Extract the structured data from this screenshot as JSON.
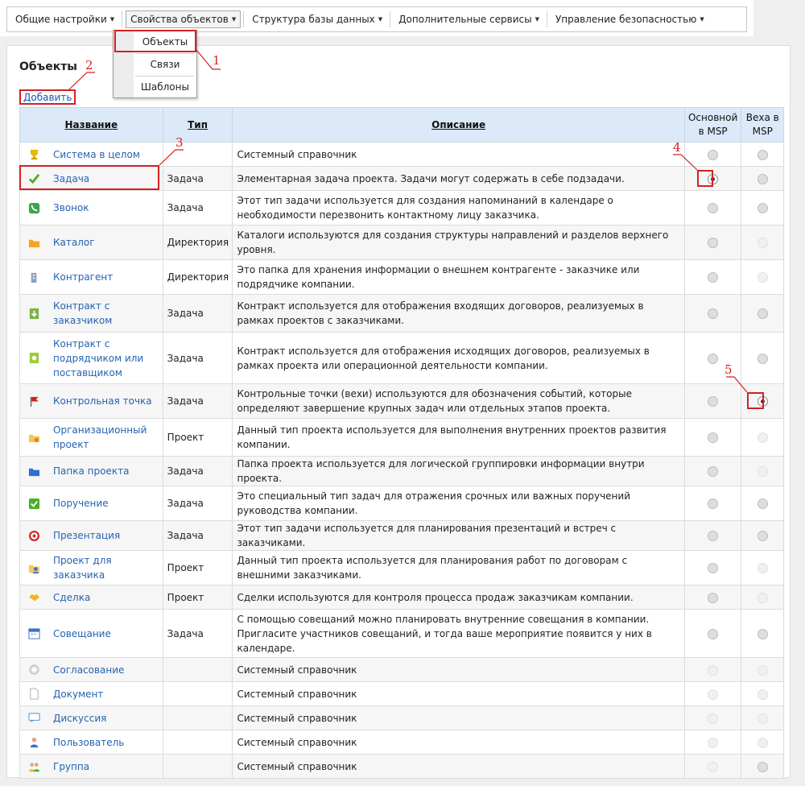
{
  "menu": {
    "items": [
      {
        "label": "Общие настройки"
      },
      {
        "label": "Свойства объектов"
      },
      {
        "label": "Структура базы данных"
      },
      {
        "label": "Дополнительные сервисы"
      },
      {
        "label": "Управление безопасностью"
      }
    ],
    "dropdown": [
      "Объекты",
      "Связи",
      "Шаблоны"
    ]
  },
  "page": {
    "title": "Объекты",
    "add_label": "Добавить"
  },
  "table": {
    "headers": {
      "name": "Название",
      "type": "Тип",
      "description": "Описание",
      "msp_main": "Основной в MSP",
      "msp_milestone": "Веха в MSP"
    },
    "rows": [
      {
        "icon": "trophy-icon",
        "name": "Система в целом",
        "type": "",
        "desc": "Системный справочник",
        "main": "off",
        "milestone": "off"
      },
      {
        "icon": "checkmark-icon",
        "name": "Задача",
        "type": "Задача",
        "desc": "Элементарная задача проекта. Задачи могут содержать в себе подзадачи.",
        "main": "checked",
        "milestone": "off"
      },
      {
        "icon": "phone-icon",
        "name": "Звонок",
        "type": "Задача",
        "desc": "Этот тип задачи используется для создания напоминаний в календаре о необходимости перезвонить контактному лицу заказчика.",
        "main": "off",
        "milestone": "off"
      },
      {
        "icon": "folder-icon",
        "name": "Каталог",
        "type": "Директория",
        "desc": "Каталоги используются для создания структуры направлений и разделов верхнего уровня.",
        "main": "off",
        "milestone": "disabled"
      },
      {
        "icon": "building-icon",
        "name": "Контрагент",
        "type": "Директория",
        "desc": "Это папка для хранения информации о внешнем контрагенте - заказчике или подрядчике компании.",
        "main": "off",
        "milestone": "disabled"
      },
      {
        "icon": "contract-in-icon",
        "name": "Контракт с заказчиком",
        "type": "Задача",
        "desc": "Контракт используется для отображения входящих договоров, реализуемых в рамках проектов с заказчиками.",
        "main": "off",
        "milestone": "off"
      },
      {
        "icon": "contract-out-icon",
        "name": "Контракт с подрядчиком или поставщиком",
        "type": "Задача",
        "desc": "Контракт используется для отображения исходящих договоров, реализуемых в рамках проекта или операционной деятельности компании.",
        "main": "off",
        "milestone": "off"
      },
      {
        "icon": "flag-icon",
        "name": "Контрольная точка",
        "type": "Задача",
        "desc": "Контрольные точки (вехи) используются для обозначения событий, которые определяют завершение крупных задач или отдельных этапов проекта.",
        "main": "off",
        "milestone": "checked"
      },
      {
        "icon": "org-folder-icon",
        "name": "Организационный проект",
        "type": "Проект",
        "desc": "Данный тип проекта используется для выполнения внутренних проектов развития компании.",
        "main": "off",
        "milestone": "disabled"
      },
      {
        "icon": "project-folder-icon",
        "name": "Папка проекта",
        "type": "Задача",
        "desc": "Папка проекта используется для логической группировки информации внутри проекта.",
        "main": "off",
        "milestone": "disabled"
      },
      {
        "icon": "assignment-icon",
        "name": "Поручение",
        "type": "Задача",
        "desc": "Это специальный тип задач для отражения срочных или важных поручений руководства компании.",
        "main": "off",
        "milestone": "off"
      },
      {
        "icon": "target-icon",
        "name": "Презентация",
        "type": "Задача",
        "desc": "Этот тип задачи используется для планирования презентаций и встреч с заказчиками.",
        "main": "off",
        "milestone": "off"
      },
      {
        "icon": "client-project-icon",
        "name": "Проект для заказчика",
        "type": "Проект",
        "desc": "Данный тип проекта используется для планирования работ по договорам с внешними заказчиками.",
        "main": "off",
        "milestone": "disabled"
      },
      {
        "icon": "handshake-icon",
        "name": "Сделка",
        "type": "Проект",
        "desc": "Сделки используются для контроля процесса продаж заказчикам компании.",
        "main": "off",
        "milestone": "disabled"
      },
      {
        "icon": "calendar-icon",
        "name": "Совещание",
        "type": "Задача",
        "desc": "С помощью совещаний можно планировать внутренние совещания в компании. Пригласите участников совещаний, и тогда ваше мероприятие появится у них в календаре.",
        "main": "off",
        "milestone": "off"
      },
      {
        "icon": "stamp-icon",
        "name": "Согласование",
        "type": "",
        "desc": "Системный справочник",
        "main": "disabled",
        "milestone": "disabled"
      },
      {
        "icon": "document-icon",
        "name": "Документ",
        "type": "",
        "desc": "Системный справочник",
        "main": "disabled",
        "milestone": "disabled"
      },
      {
        "icon": "discussion-icon",
        "name": "Дискуссия",
        "type": "",
        "desc": "Системный справочник",
        "main": "disabled",
        "milestone": "disabled"
      },
      {
        "icon": "user-icon",
        "name": "Пользователь",
        "type": "",
        "desc": "Системный справочник",
        "main": "disabled",
        "milestone": "disabled"
      },
      {
        "icon": "group-icon",
        "name": "Группа",
        "type": "",
        "desc": "Системный справочник",
        "main": "disabled",
        "milestone": "off"
      }
    ]
  },
  "callouts": [
    "1",
    "2",
    "3",
    "4",
    "5"
  ]
}
